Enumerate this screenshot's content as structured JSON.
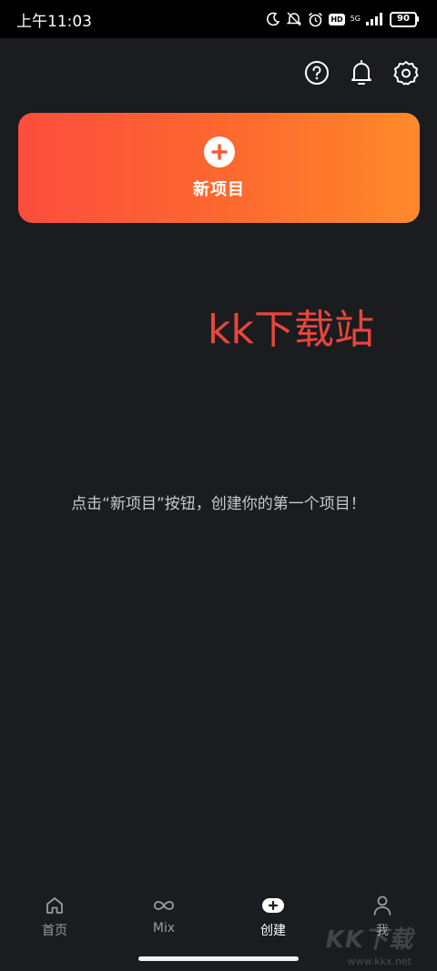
{
  "status_bar": {
    "time": "上午11:03",
    "network": "5G",
    "hd": "HD",
    "battery": "90"
  },
  "toolbar": {
    "icons": [
      "help-icon",
      "notification-bell-icon",
      "settings-gear-icon"
    ]
  },
  "new_project": {
    "label": "新项目",
    "gradient_start": "#fb4d3d",
    "gradient_end": "#ff8a2a"
  },
  "watermark": {
    "text": "kk下载站",
    "color": "#e8463a"
  },
  "empty_state": {
    "message": "点击“新项目”按钮，创建你的第一个项目！"
  },
  "bottom_nav": {
    "items": [
      {
        "label": "首页",
        "icon": "home-icon",
        "active": false
      },
      {
        "label": "Mix",
        "icon": "infinity-icon",
        "active": false
      },
      {
        "label": "创建",
        "icon": "create-plus-icon",
        "active": true
      },
      {
        "label": "我",
        "icon": "profile-icon",
        "active": false
      }
    ]
  },
  "corner_watermark": {
    "logo": "KK下载",
    "url": "www.kkx.net"
  }
}
